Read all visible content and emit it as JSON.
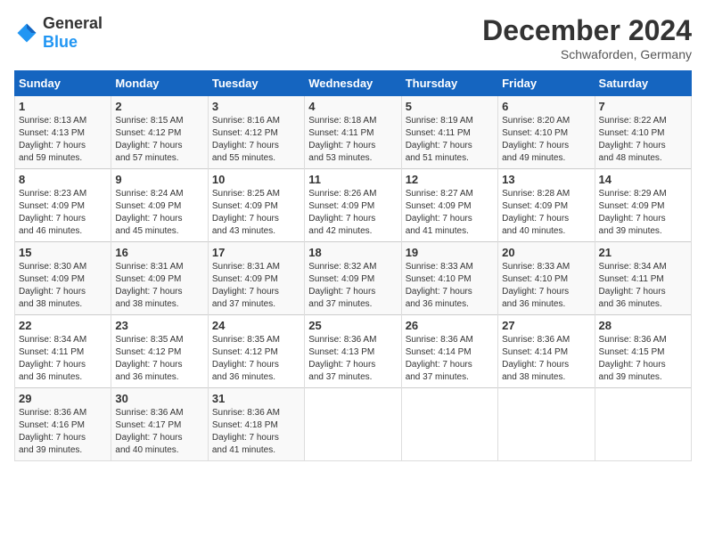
{
  "header": {
    "logo": {
      "general": "General",
      "blue": "Blue"
    },
    "title": "December 2024",
    "location": "Schwaforden, Germany"
  },
  "days_of_week": [
    "Sunday",
    "Monday",
    "Tuesday",
    "Wednesday",
    "Thursday",
    "Friday",
    "Saturday"
  ],
  "weeks": [
    [
      {
        "day": "1",
        "sunrise": "8:13 AM",
        "sunset": "4:13 PM",
        "daylight": "7 hours and 59 minutes."
      },
      {
        "day": "2",
        "sunrise": "8:15 AM",
        "sunset": "4:12 PM",
        "daylight": "7 hours and 57 minutes."
      },
      {
        "day": "3",
        "sunrise": "8:16 AM",
        "sunset": "4:12 PM",
        "daylight": "7 hours and 55 minutes."
      },
      {
        "day": "4",
        "sunrise": "8:18 AM",
        "sunset": "4:11 PM",
        "daylight": "7 hours and 53 minutes."
      },
      {
        "day": "5",
        "sunrise": "8:19 AM",
        "sunset": "4:11 PM",
        "daylight": "7 hours and 51 minutes."
      },
      {
        "day": "6",
        "sunrise": "8:20 AM",
        "sunset": "4:10 PM",
        "daylight": "7 hours and 49 minutes."
      },
      {
        "day": "7",
        "sunrise": "8:22 AM",
        "sunset": "4:10 PM",
        "daylight": "7 hours and 48 minutes."
      }
    ],
    [
      {
        "day": "8",
        "sunrise": "8:23 AM",
        "sunset": "4:09 PM",
        "daylight": "7 hours and 46 minutes."
      },
      {
        "day": "9",
        "sunrise": "8:24 AM",
        "sunset": "4:09 PM",
        "daylight": "7 hours and 45 minutes."
      },
      {
        "day": "10",
        "sunrise": "8:25 AM",
        "sunset": "4:09 PM",
        "daylight": "7 hours and 43 minutes."
      },
      {
        "day": "11",
        "sunrise": "8:26 AM",
        "sunset": "4:09 PM",
        "daylight": "7 hours and 42 minutes."
      },
      {
        "day": "12",
        "sunrise": "8:27 AM",
        "sunset": "4:09 PM",
        "daylight": "7 hours and 41 minutes."
      },
      {
        "day": "13",
        "sunrise": "8:28 AM",
        "sunset": "4:09 PM",
        "daylight": "7 hours and 40 minutes."
      },
      {
        "day": "14",
        "sunrise": "8:29 AM",
        "sunset": "4:09 PM",
        "daylight": "7 hours and 39 minutes."
      }
    ],
    [
      {
        "day": "15",
        "sunrise": "8:30 AM",
        "sunset": "4:09 PM",
        "daylight": "7 hours and 38 minutes."
      },
      {
        "day": "16",
        "sunrise": "8:31 AM",
        "sunset": "4:09 PM",
        "daylight": "7 hours and 38 minutes."
      },
      {
        "day": "17",
        "sunrise": "8:31 AM",
        "sunset": "4:09 PM",
        "daylight": "7 hours and 37 minutes."
      },
      {
        "day": "18",
        "sunrise": "8:32 AM",
        "sunset": "4:09 PM",
        "daylight": "7 hours and 37 minutes."
      },
      {
        "day": "19",
        "sunrise": "8:33 AM",
        "sunset": "4:10 PM",
        "daylight": "7 hours and 36 minutes."
      },
      {
        "day": "20",
        "sunrise": "8:33 AM",
        "sunset": "4:10 PM",
        "daylight": "7 hours and 36 minutes."
      },
      {
        "day": "21",
        "sunrise": "8:34 AM",
        "sunset": "4:11 PM",
        "daylight": "7 hours and 36 minutes."
      }
    ],
    [
      {
        "day": "22",
        "sunrise": "8:34 AM",
        "sunset": "4:11 PM",
        "daylight": "7 hours and 36 minutes."
      },
      {
        "day": "23",
        "sunrise": "8:35 AM",
        "sunset": "4:12 PM",
        "daylight": "7 hours and 36 minutes."
      },
      {
        "day": "24",
        "sunrise": "8:35 AM",
        "sunset": "4:12 PM",
        "daylight": "7 hours and 36 minutes."
      },
      {
        "day": "25",
        "sunrise": "8:36 AM",
        "sunset": "4:13 PM",
        "daylight": "7 hours and 37 minutes."
      },
      {
        "day": "26",
        "sunrise": "8:36 AM",
        "sunset": "4:14 PM",
        "daylight": "7 hours and 37 minutes."
      },
      {
        "day": "27",
        "sunrise": "8:36 AM",
        "sunset": "4:14 PM",
        "daylight": "7 hours and 38 minutes."
      },
      {
        "day": "28",
        "sunrise": "8:36 AM",
        "sunset": "4:15 PM",
        "daylight": "7 hours and 39 minutes."
      }
    ],
    [
      {
        "day": "29",
        "sunrise": "8:36 AM",
        "sunset": "4:16 PM",
        "daylight": "7 hours and 39 minutes."
      },
      {
        "day": "30",
        "sunrise": "8:36 AM",
        "sunset": "4:17 PM",
        "daylight": "7 hours and 40 minutes."
      },
      {
        "day": "31",
        "sunrise": "8:36 AM",
        "sunset": "4:18 PM",
        "daylight": "7 hours and 41 minutes."
      },
      null,
      null,
      null,
      null
    ]
  ],
  "labels": {
    "sunrise": "Sunrise: ",
    "sunset": "Sunset: ",
    "daylight": "Daylight: "
  }
}
